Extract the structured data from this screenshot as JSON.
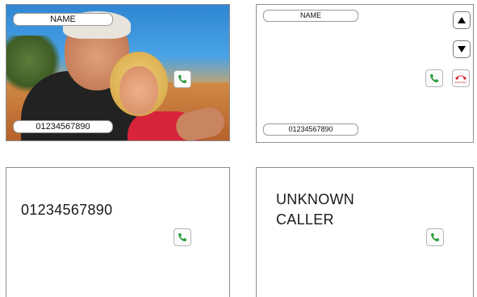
{
  "screens": {
    "photo": {
      "name": "NAME",
      "number": "01234567890"
    },
    "list": {
      "name": "NAME",
      "number": "01234567890",
      "end_call_label": "END CALL"
    },
    "number_only": {
      "number": "01234567890"
    },
    "unknown": {
      "line1": "UNKNOWN",
      "line2": "CALLER"
    }
  },
  "icons": {
    "answer": "phone-answer-icon",
    "end": "phone-end-icon",
    "up": "arrow-up-icon",
    "down": "arrow-down-icon"
  },
  "colors": {
    "answer_green": "#2f9e3f",
    "end_red": "#d8232a"
  }
}
